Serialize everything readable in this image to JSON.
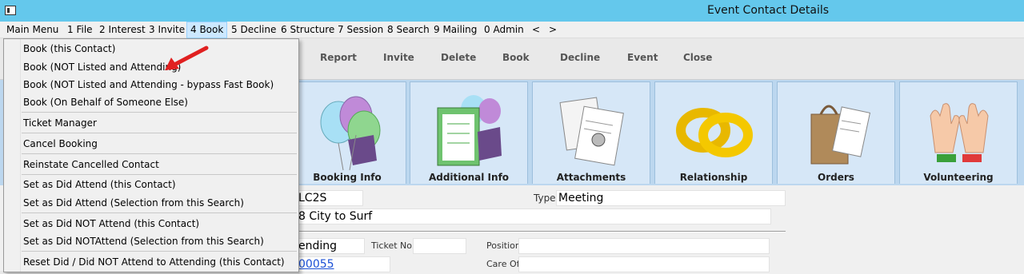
{
  "window": {
    "title": "Event Contact Details"
  },
  "menubar": {
    "items": [
      "Main Menu",
      "1 File",
      "2 Interest",
      "3 Invite",
      "4 Book",
      "5 Decline",
      "6 Structure",
      "7 Session",
      "8 Search",
      "9 Mailing",
      "0 Admin",
      "<",
      ">"
    ],
    "active": "4 Book"
  },
  "toolbar": {
    "report": "Report",
    "invite": "Invite",
    "delete": "Delete",
    "book": "Book",
    "decline": "Decline",
    "event": "Event",
    "close": "Close"
  },
  "tiles": {
    "booking_info": "Booking Info",
    "additional_info": "Additional Info",
    "attachments": "Attachments",
    "relationship": "Relationship",
    "orders": "Orders",
    "volunteering": "Volunteering"
  },
  "book_menu": {
    "book_this_contact": "Book (this Contact)",
    "book_not_listed": "Book (NOT Listed and Attending)",
    "book_not_listed_bypass": "Book (NOT Listed and Attending - bypass Fast Book)",
    "book_on_behalf": "Book (On Behalf of Someone Else)",
    "ticket_manager": "Ticket Manager",
    "cancel_booking": "Cancel Booking",
    "reinstate": "Reinstate Cancelled Contact",
    "did_attend_this": "Set as Did Attend (this Contact)",
    "did_attend_selection": "Set as Did Attend (Selection from this Search)",
    "did_not_attend_this": "Set as Did NOT Attend (this Contact)",
    "did_not_attend_selection": "Set as Did NOTAttend (Selection from this Search)",
    "reset_attending": "Reset Did / Did NOT Attend to Attending (this Contact)"
  },
  "form": {
    "event_code": "LC2S",
    "type_label": "Type",
    "type_value": "Meeting",
    "event_name": "8 City to Surf",
    "status_value": "ending",
    "ticket_label": "Ticket No.",
    "ticket_value": "",
    "position_label": "Position",
    "position_value": "",
    "contact_link": "00055",
    "care_of_label": "Care Of",
    "care_of_value": ""
  },
  "colors": {
    "titlebar": "#64c8ec",
    "tiles_bg": "#bcd7ef",
    "menu_highlight": "#cce8ff",
    "arrow": "#e02020"
  }
}
